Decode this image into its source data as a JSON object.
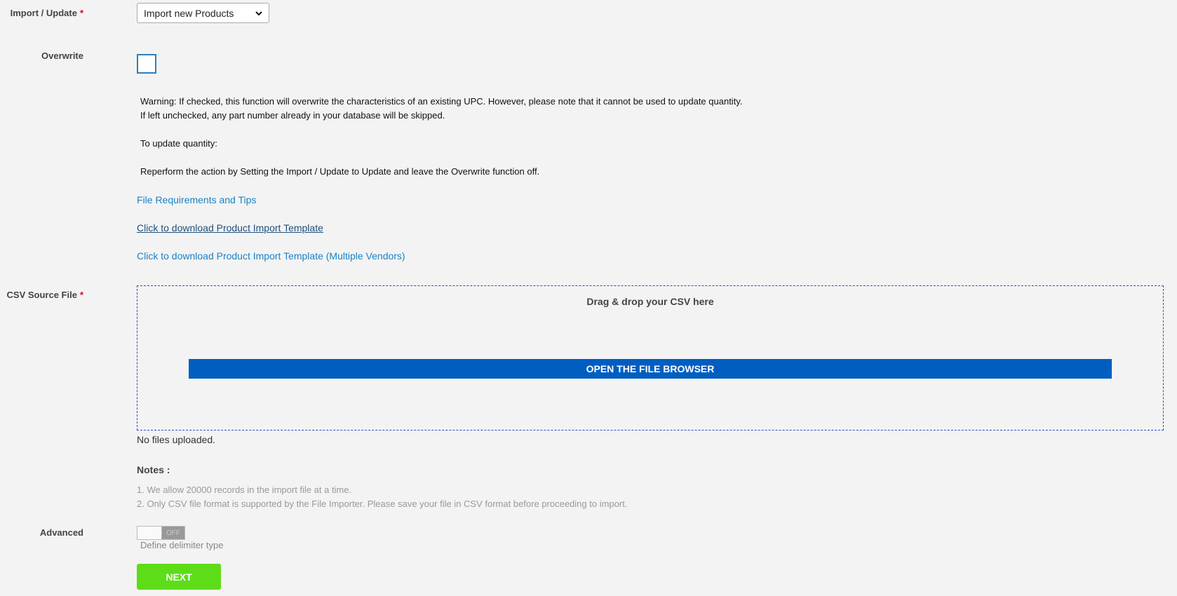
{
  "import_update": {
    "label": "Import / Update",
    "required_mark": "*",
    "selected": "Import new Products",
    "icon": "chevron-down-icon"
  },
  "overwrite": {
    "label": "Overwrite",
    "checked": false
  },
  "warning": {
    "line1": "Warning: If checked, this function will overwrite the characteristics of an existing UPC. However, please note that it cannot be used to update quantity.",
    "line2": "If left unchecked, any part number already in your database will be skipped.",
    "line3": "To update quantity:",
    "line4": "Reperform the action by Setting the Import / Update to Update and leave the Overwrite function off."
  },
  "links": {
    "file_requirements": "File Requirements and Tips",
    "download_template": "Click to download Product Import Template",
    "download_template_multi": "Click to download Product Import Template (Multiple Vendors)"
  },
  "csv_source": {
    "label": "CSV Source File",
    "required_mark": "*",
    "drop_text": "Drag & drop your CSV here",
    "browse_button": "OPEN THE FILE BROWSER",
    "status": "No files uploaded."
  },
  "notes": {
    "title": "Notes :",
    "items": [
      "1. We allow 20000 records in the import file at a time.",
      "2. Only CSV file format is supported by the File Importer. Please save your file in CSV format before proceeding to import."
    ]
  },
  "advanced": {
    "label": "Advanced",
    "toggle_state": "OFF",
    "hint": "Define delimiter type"
  },
  "actions": {
    "next": "NEXT"
  },
  "colors": {
    "accent_blue": "#005ec1",
    "link_blue": "#1b82c4",
    "next_green": "#5ddd18",
    "required_red": "#d9001b"
  }
}
